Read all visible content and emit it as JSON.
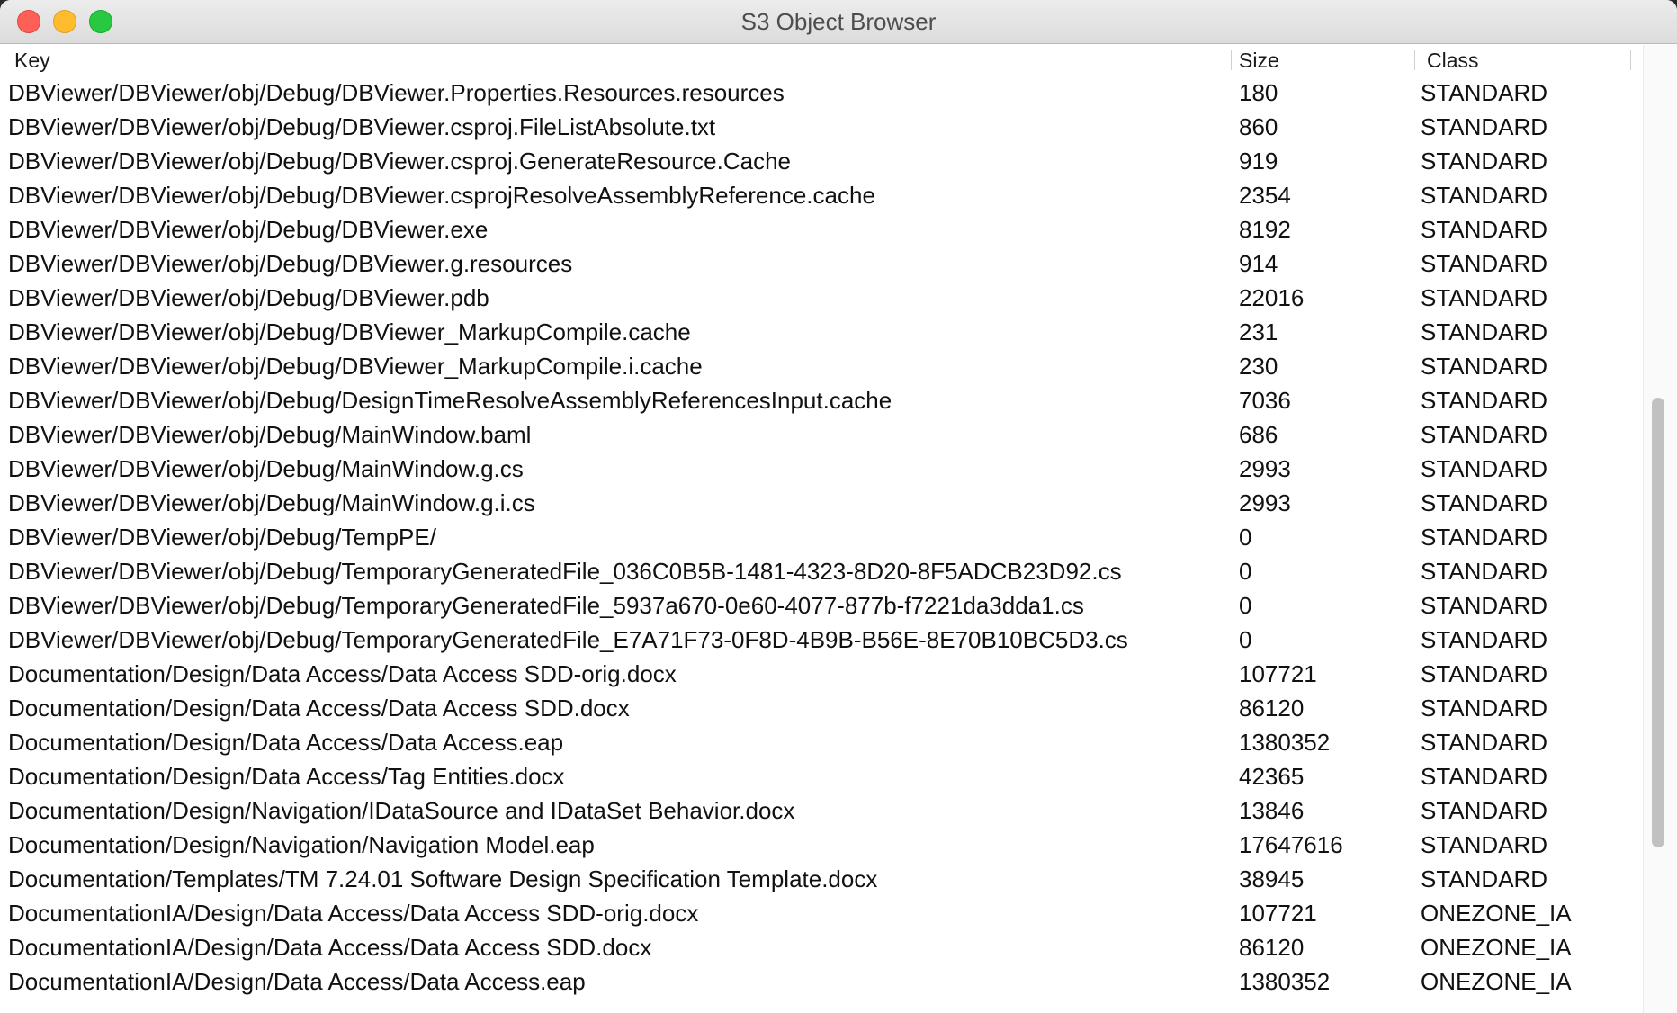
{
  "window": {
    "title": "S3 Object Browser"
  },
  "table": {
    "columns": {
      "key": "Key",
      "size": "Size",
      "class": "Class"
    },
    "rows": [
      {
        "key": "DBViewer/DBViewer/obj/Debug/DBViewer.Properties.Resources.resources",
        "size": "180",
        "class": "STANDARD"
      },
      {
        "key": "DBViewer/DBViewer/obj/Debug/DBViewer.csproj.FileListAbsolute.txt",
        "size": "860",
        "class": "STANDARD"
      },
      {
        "key": "DBViewer/DBViewer/obj/Debug/DBViewer.csproj.GenerateResource.Cache",
        "size": "919",
        "class": "STANDARD"
      },
      {
        "key": "DBViewer/DBViewer/obj/Debug/DBViewer.csprojResolveAssemblyReference.cache",
        "size": "2354",
        "class": "STANDARD"
      },
      {
        "key": "DBViewer/DBViewer/obj/Debug/DBViewer.exe",
        "size": "8192",
        "class": "STANDARD"
      },
      {
        "key": "DBViewer/DBViewer/obj/Debug/DBViewer.g.resources",
        "size": "914",
        "class": "STANDARD"
      },
      {
        "key": "DBViewer/DBViewer/obj/Debug/DBViewer.pdb",
        "size": "22016",
        "class": "STANDARD"
      },
      {
        "key": "DBViewer/DBViewer/obj/Debug/DBViewer_MarkupCompile.cache",
        "size": "231",
        "class": "STANDARD"
      },
      {
        "key": "DBViewer/DBViewer/obj/Debug/DBViewer_MarkupCompile.i.cache",
        "size": "230",
        "class": "STANDARD"
      },
      {
        "key": "DBViewer/DBViewer/obj/Debug/DesignTimeResolveAssemblyReferencesInput.cache",
        "size": "7036",
        "class": "STANDARD"
      },
      {
        "key": "DBViewer/DBViewer/obj/Debug/MainWindow.baml",
        "size": "686",
        "class": "STANDARD"
      },
      {
        "key": "DBViewer/DBViewer/obj/Debug/MainWindow.g.cs",
        "size": "2993",
        "class": "STANDARD"
      },
      {
        "key": "DBViewer/DBViewer/obj/Debug/MainWindow.g.i.cs",
        "size": "2993",
        "class": "STANDARD"
      },
      {
        "key": "DBViewer/DBViewer/obj/Debug/TempPE/",
        "size": "0",
        "class": "STANDARD"
      },
      {
        "key": "DBViewer/DBViewer/obj/Debug/TemporaryGeneratedFile_036C0B5B-1481-4323-8D20-8F5ADCB23D92.cs",
        "size": "0",
        "class": "STANDARD"
      },
      {
        "key": "DBViewer/DBViewer/obj/Debug/TemporaryGeneratedFile_5937a670-0e60-4077-877b-f7221da3dda1.cs",
        "size": "0",
        "class": "STANDARD"
      },
      {
        "key": "DBViewer/DBViewer/obj/Debug/TemporaryGeneratedFile_E7A71F73-0F8D-4B9B-B56E-8E70B10BC5D3.cs",
        "size": "0",
        "class": "STANDARD"
      },
      {
        "key": "Documentation/Design/Data Access/Data Access SDD-orig.docx",
        "size": "107721",
        "class": "STANDARD"
      },
      {
        "key": "Documentation/Design/Data Access/Data Access SDD.docx",
        "size": "86120",
        "class": "STANDARD"
      },
      {
        "key": "Documentation/Design/Data Access/Data Access.eap",
        "size": "1380352",
        "class": "STANDARD"
      },
      {
        "key": "Documentation/Design/Data Access/Tag Entities.docx",
        "size": "42365",
        "class": "STANDARD"
      },
      {
        "key": "Documentation/Design/Navigation/IDataSource and IDataSet Behavior.docx",
        "size": "13846",
        "class": "STANDARD"
      },
      {
        "key": "Documentation/Design/Navigation/Navigation Model.eap",
        "size": "17647616",
        "class": "STANDARD"
      },
      {
        "key": "Documentation/Templates/TM 7.24.01 Software Design Specification Template.docx",
        "size": "38945",
        "class": "STANDARD"
      },
      {
        "key": "DocumentationIA/Design/Data Access/Data Access SDD-orig.docx",
        "size": "107721",
        "class": "ONEZONE_IA"
      },
      {
        "key": "DocumentationIA/Design/Data Access/Data Access SDD.docx",
        "size": "86120",
        "class": "ONEZONE_IA"
      },
      {
        "key": "DocumentationIA/Design/Data Access/Data Access.eap",
        "size": "1380352",
        "class": "ONEZONE_IA"
      }
    ]
  }
}
